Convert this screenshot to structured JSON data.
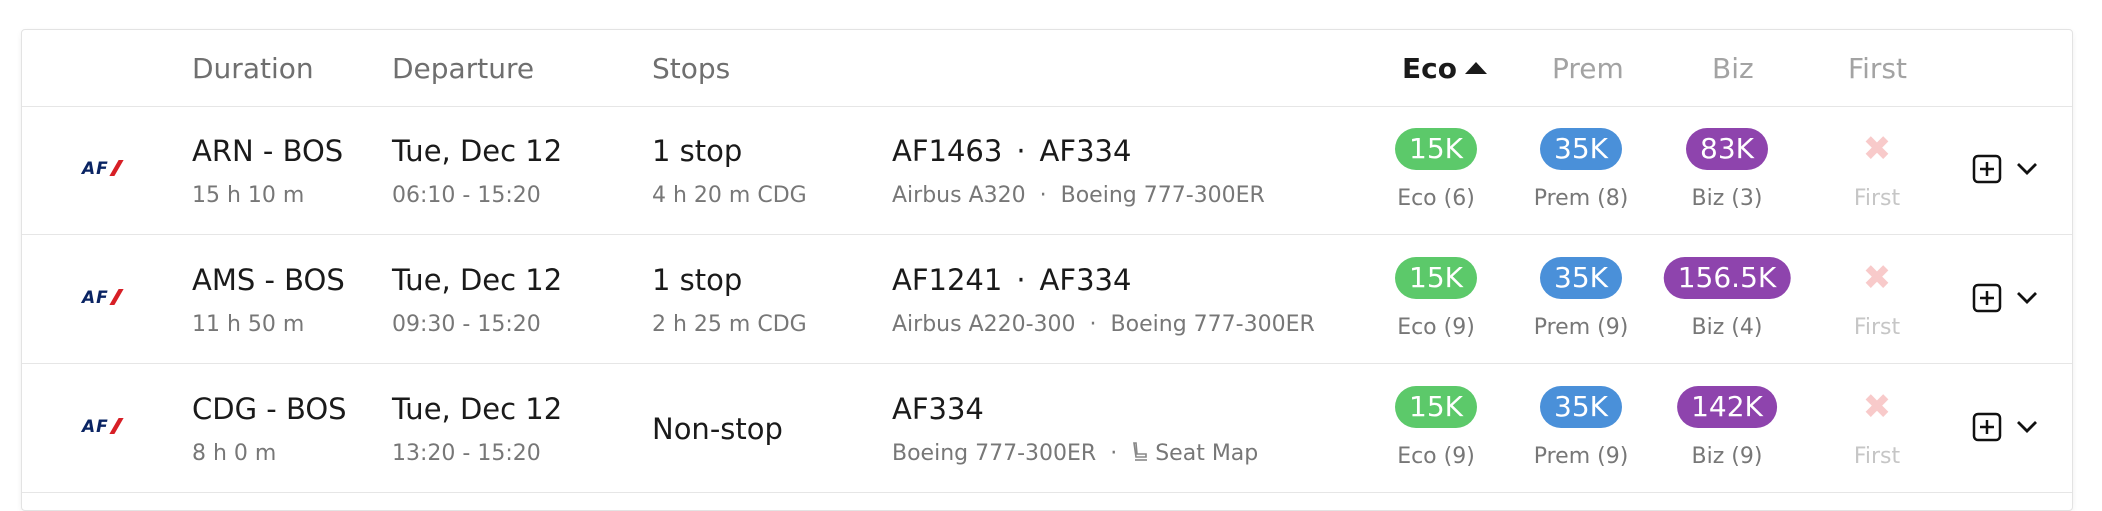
{
  "header": {
    "duration": "Duration",
    "departure": "Departure",
    "stops": "Stops",
    "eco": "Eco",
    "prem": "Prem",
    "biz": "Biz",
    "first": "First"
  },
  "colors": {
    "eco": "#5cc96a",
    "prem": "#4a90d9",
    "biz": "#8e44ad",
    "first_unavailable": "#f8caca"
  },
  "rows": [
    {
      "airline_logo": "AF",
      "route": "ARN - BOS",
      "duration": "15 h 10 m",
      "date": "Tue, Dec 12",
      "times": "06:10 - 15:20",
      "stops": "1 stop",
      "layover": "4 h 20 m  CDG",
      "flight1": "AF1463",
      "flight2": "AF334",
      "aircraft1": "Airbus A320",
      "aircraft2": "Boeing 777-300ER",
      "eco_price": "15K",
      "eco_label": "Eco (6)",
      "prem_price": "35K",
      "prem_label": "Prem (8)",
      "biz_price": "83K",
      "biz_label": "Biz (3)",
      "first_label": "First"
    },
    {
      "airline_logo": "AF",
      "route": "AMS - BOS",
      "duration": "11 h 50 m",
      "date": "Tue, Dec 12",
      "times": "09:30 - 15:20",
      "stops": "1 stop",
      "layover": "2 h 25 m  CDG",
      "flight1": "AF1241",
      "flight2": "AF334",
      "aircraft1": "Airbus A220-300",
      "aircraft2": "Boeing 777-300ER",
      "eco_price": "15K",
      "eco_label": "Eco (9)",
      "prem_price": "35K",
      "prem_label": "Prem (9)",
      "biz_price": "156.5K",
      "biz_label": "Biz (4)",
      "first_label": "First"
    },
    {
      "airline_logo": "AF",
      "route": "CDG - BOS",
      "duration": "8 h 0 m",
      "date": "Tue, Dec 12",
      "times": "13:20 - 15:20",
      "stops": "Non-stop",
      "flight1": "AF334",
      "aircraft1": "Boeing 777-300ER",
      "seat_map": "Seat Map",
      "eco_price": "15K",
      "eco_label": "Eco (9)",
      "prem_price": "35K",
      "prem_label": "Prem (9)",
      "biz_price": "142K",
      "biz_label": "Biz (9)",
      "first_label": "First"
    }
  ]
}
